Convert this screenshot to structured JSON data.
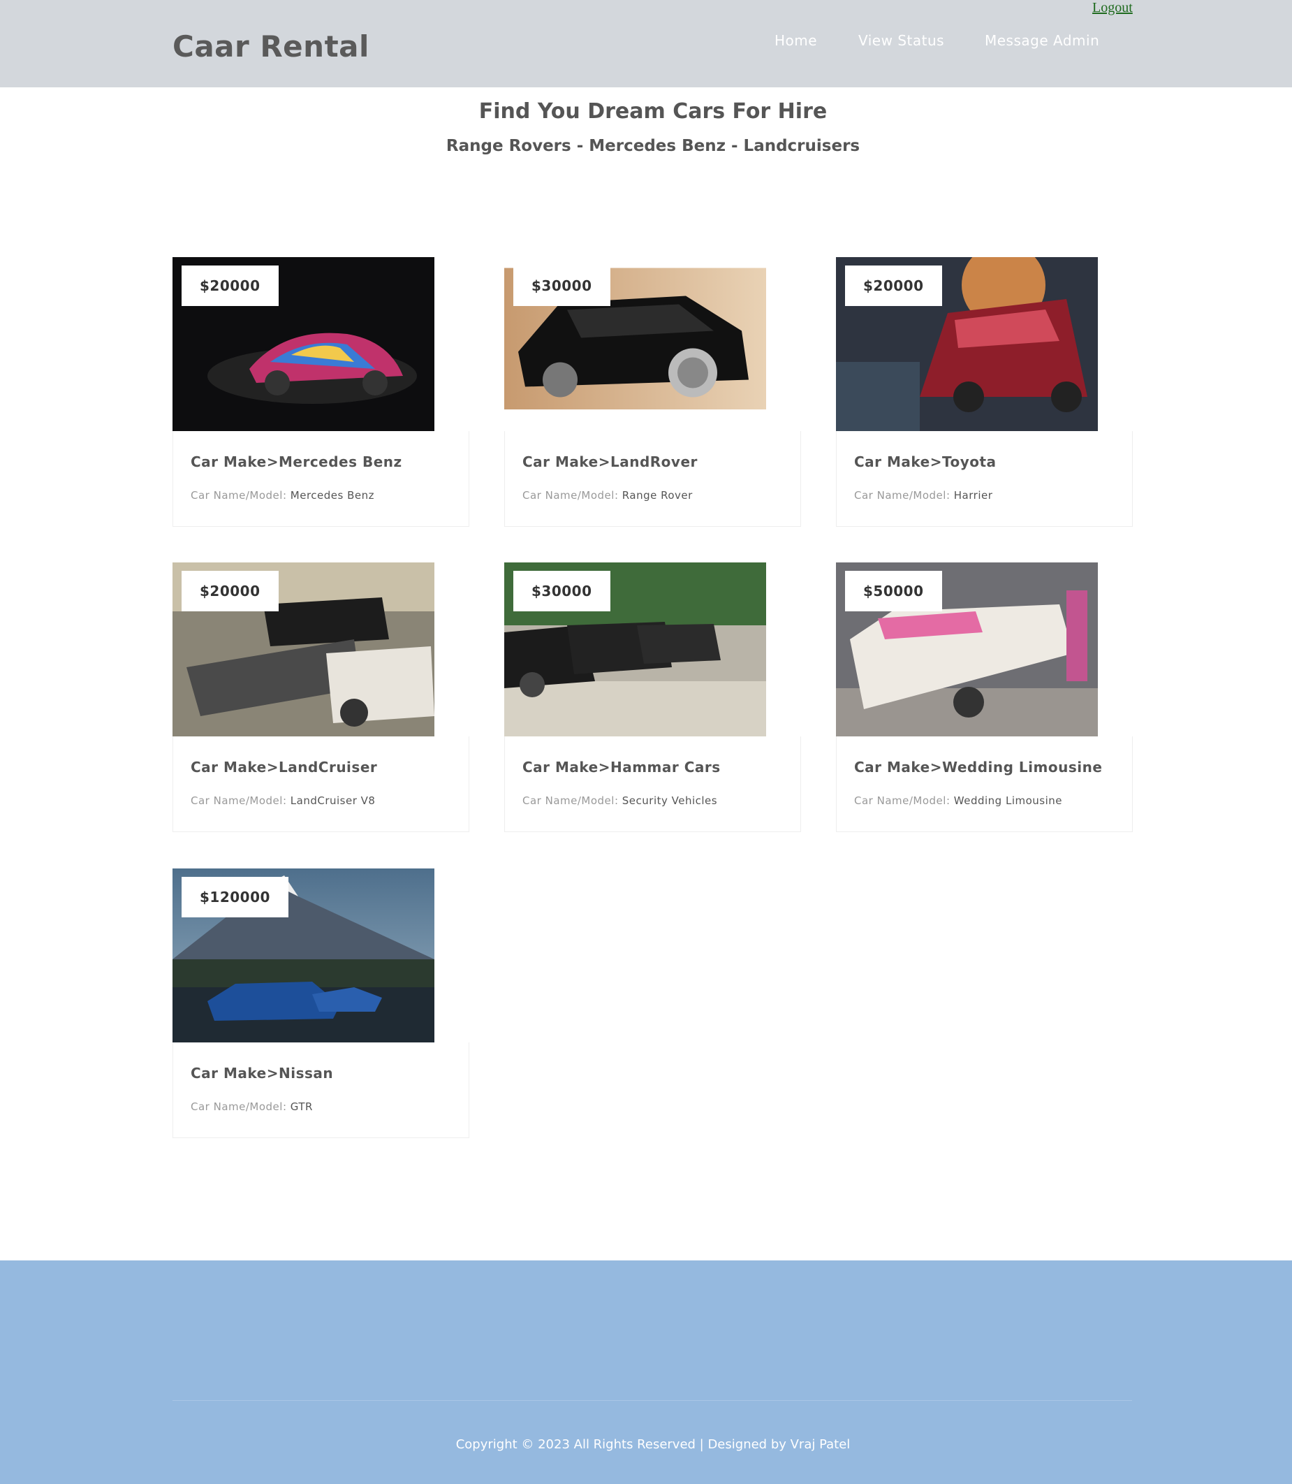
{
  "header": {
    "logout_label": "Logout",
    "brand": "Caar Rental",
    "nav": [
      "Home",
      "View Status",
      "Message Admin"
    ]
  },
  "hero": {
    "title": "Find You Dream Cars For Hire",
    "subtitle": "Range Rovers - Mercedes Benz - Landcruisers"
  },
  "cars": [
    {
      "price": "$20000",
      "make": "Car Make>Mercedes Benz",
      "model_label": "Car Name/Model:",
      "model": "Mercedes Benz"
    },
    {
      "price": "$30000",
      "make": "Car Make>LandRover",
      "model_label": "Car Name/Model:",
      "model": "Range Rover"
    },
    {
      "price": "$20000",
      "make": "Car Make>Toyota",
      "model_label": "Car Name/Model:",
      "model": "Harrier"
    },
    {
      "price": "$20000",
      "make": "Car Make>LandCruiser",
      "model_label": "Car Name/Model:",
      "model": "LandCruiser V8"
    },
    {
      "price": "$30000",
      "make": "Car Make>Hammar Cars",
      "model_label": "Car Name/Model:",
      "model": "Security Vehicles"
    },
    {
      "price": "$50000",
      "make": "Car Make>Wedding Limousine",
      "model_label": "Car Name/Model:",
      "model": "Wedding Limousine"
    },
    {
      "price": "$120000",
      "make": "Car Make>Nissan",
      "model_label": "Car Name/Model:",
      "model": "GTR"
    }
  ],
  "footer": {
    "copyright": "Copyright © 2023 All Rights Reserved | Designed by Vraj Patel"
  }
}
